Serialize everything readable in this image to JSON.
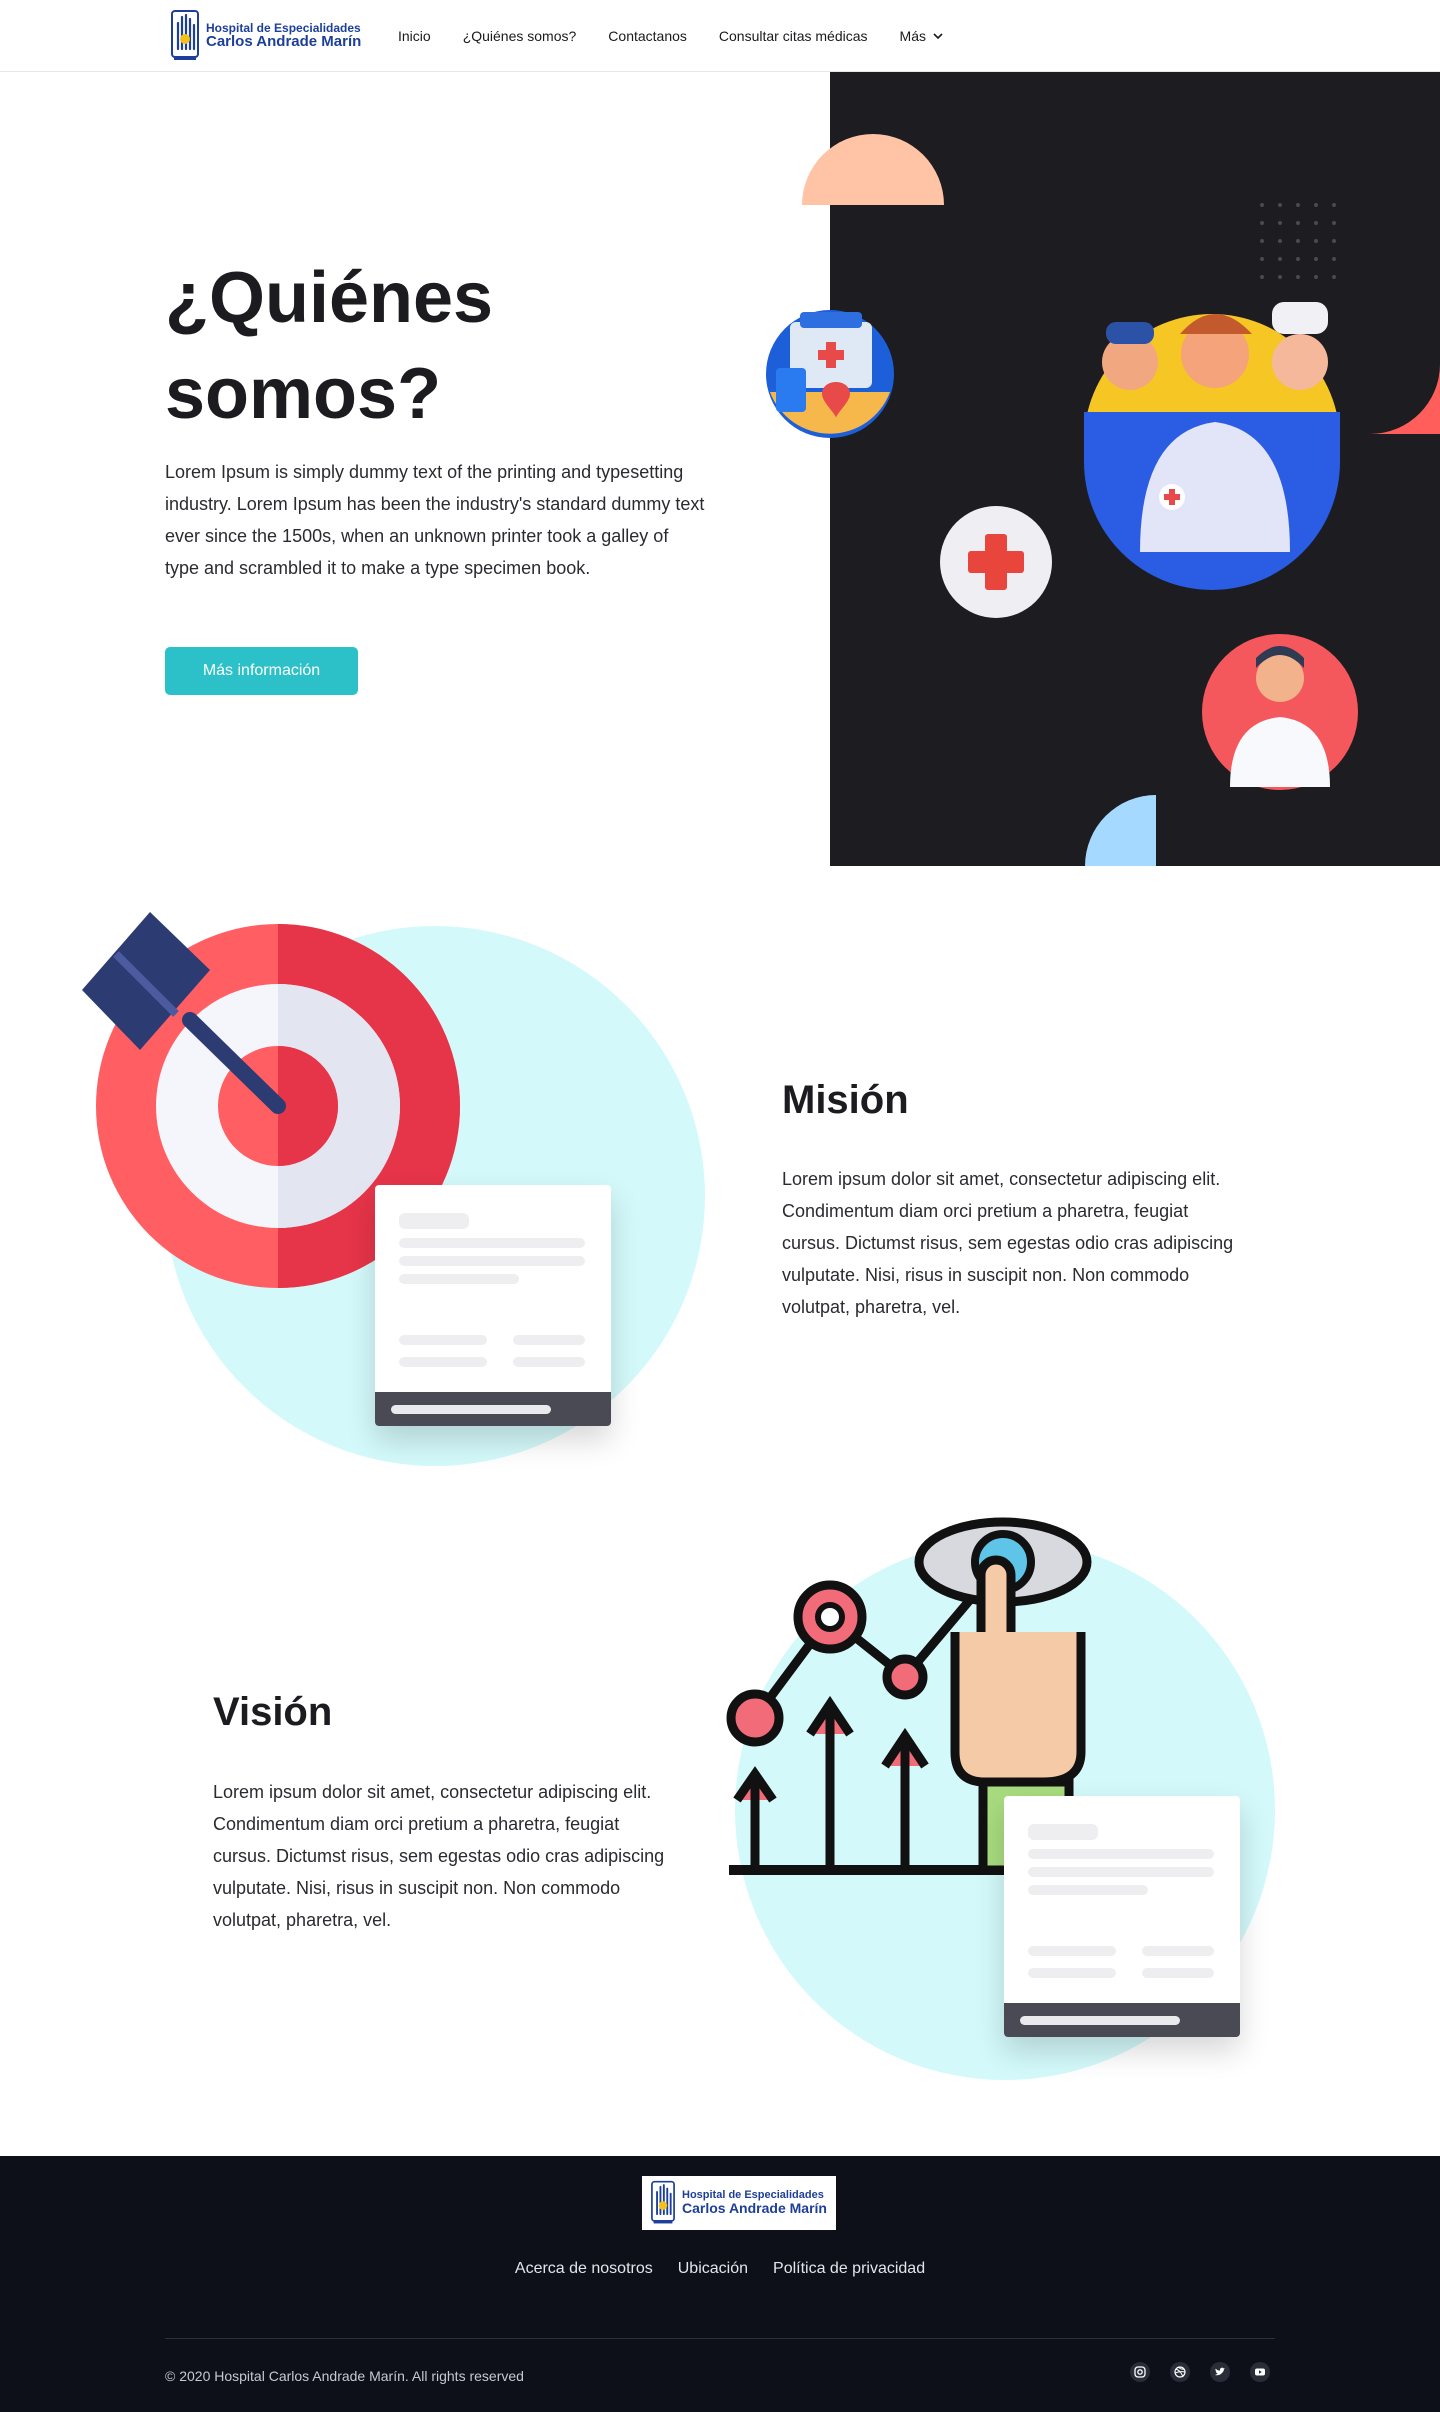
{
  "brand": {
    "line1": "Hospital de Especialidades",
    "line2": "Carlos Andrade Marín"
  },
  "nav": {
    "items": [
      "Inicio",
      "¿Quiénes somos?",
      "Contactanos",
      "Consultar citas médicas",
      "Más"
    ]
  },
  "hero": {
    "title": "¿Quiénes somos?",
    "text": "Lorem Ipsum is simply dummy text of the printing and typesetting industry. Lorem Ipsum has been the industry's standard dummy text ever since the 1500s, when an unknown printer took a galley of type and scrambled it to make a type specimen book.",
    "button": "Más información"
  },
  "mision": {
    "title": "Misión",
    "text": "Lorem ipsum dolor sit amet, consectetur adipiscing elit. Condimentum diam orci pretium a pharetra, feugiat cursus. Dictumst risus, sem egestas odio cras adipiscing vulputate. Nisi, risus in suscipit non. Non commodo volutpat, pharetra, vel."
  },
  "vision": {
    "title": "Visión",
    "text": "Lorem ipsum dolor sit amet, consectetur adipiscing elit. Condimentum diam orci pretium a pharetra, feugiat cursus. Dictumst risus, sem egestas odio cras adipiscing vulputate. Nisi, risus in suscipit non. Non commodo volutpat, pharetra, vel."
  },
  "footer": {
    "links": [
      "Acerca de nosotros",
      "Ubicación",
      "Política de privacidad"
    ],
    "copyright": "© 2020 Hospital Carlos Andrade Marín. All rights reserved",
    "social": [
      "instagram-icon",
      "dribbble-icon",
      "twitter-icon",
      "youtube-icon"
    ]
  },
  "colors": {
    "accent": "#2cc1c9",
    "dark_panel": "#1c1c21",
    "footer_bg": "#0d0f19",
    "circle_bg": "#d3f9fa",
    "brand_blue": "#1d3f9a"
  }
}
